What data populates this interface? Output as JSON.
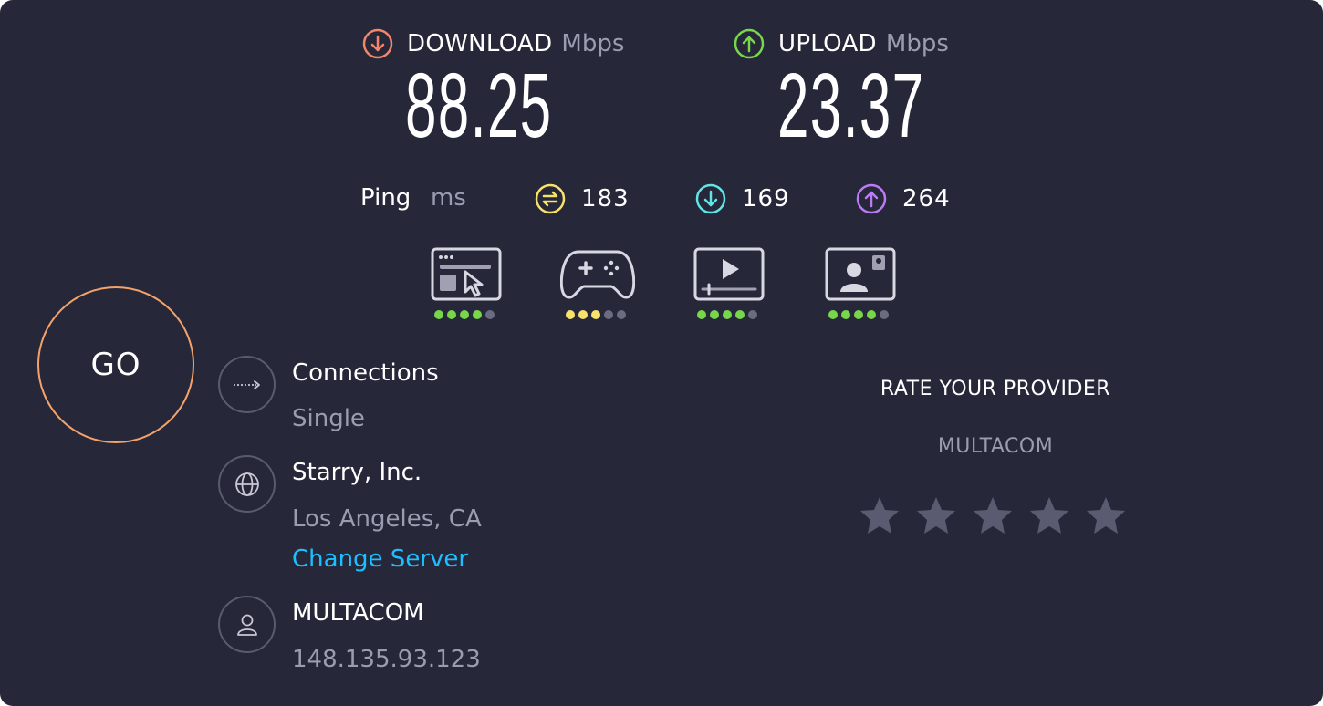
{
  "download": {
    "title": "DOWNLOAD",
    "unit": "Mbps",
    "value": "88.25",
    "icon": "arrow-down-circle-icon",
    "color": "#f2866a"
  },
  "upload": {
    "title": "UPLOAD",
    "unit": "Mbps",
    "value": "23.37",
    "icon": "arrow-up-circle-icon",
    "color": "#78d64b"
  },
  "ping": {
    "label": "Ping",
    "unit": "ms",
    "idle": {
      "value": "183",
      "icon": "idle-latency-icon",
      "color": "#f7e26b"
    },
    "download": {
      "value": "169",
      "icon": "download-latency-icon",
      "color": "#5ee6e6"
    },
    "upload": {
      "value": "264",
      "icon": "upload-latency-icon",
      "color": "#b97cf2"
    }
  },
  "use_cases": [
    {
      "name": "web-browsing-icon",
      "rating": 4,
      "max": 5,
      "color": "#78d64b"
    },
    {
      "name": "gaming-icon",
      "rating": 3,
      "max": 5,
      "color": "#f7e26b"
    },
    {
      "name": "video-streaming-icon",
      "rating": 4,
      "max": 5,
      "color": "#78d64b"
    },
    {
      "name": "video-chat-icon",
      "rating": 4,
      "max": 5,
      "color": "#78d64b"
    }
  ],
  "go_button": {
    "label": "GO",
    "color": "#f2a26a"
  },
  "connections": {
    "title": "Connections",
    "value": "Single",
    "icon": "connections-arrow-icon"
  },
  "server": {
    "title": "Starry, Inc.",
    "location": "Los Angeles, CA",
    "change_label": "Change Server",
    "icon": "globe-icon"
  },
  "client": {
    "title": "MULTACOM",
    "ip": "148.135.93.123",
    "icon": "user-icon"
  },
  "rate": {
    "title": "RATE YOUR PROVIDER",
    "provider": "MULTACOM",
    "stars": 5,
    "star_color": "#5a5b70"
  }
}
